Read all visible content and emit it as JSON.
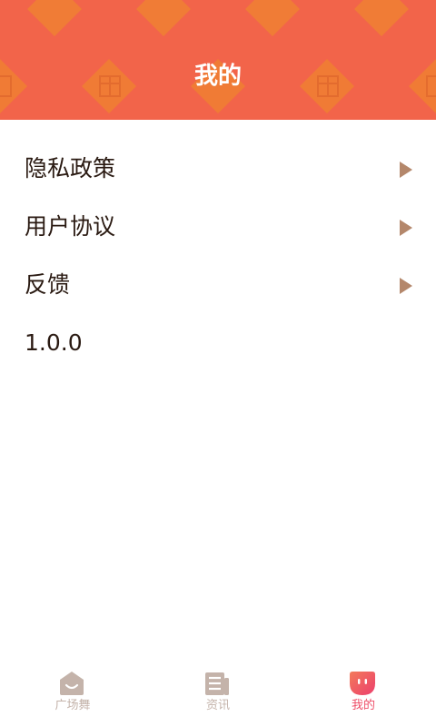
{
  "header": {
    "title": "我的"
  },
  "menu": {
    "items": [
      {
        "label": "隐私政策"
      },
      {
        "label": "用户协议"
      },
      {
        "label": "反馈"
      }
    ],
    "version": "1.0.0"
  },
  "nav": {
    "items": [
      {
        "label": "广场舞",
        "icon": "home-smile-icon",
        "active": false
      },
      {
        "label": "资讯",
        "icon": "news-icon",
        "active": false
      },
      {
        "label": "我的",
        "icon": "profile-face-icon",
        "active": true
      }
    ]
  },
  "colors": {
    "header_bg": "#F2644A",
    "pattern": "#F08032",
    "arrow": "#B4876B",
    "nav_inactive": "#C4B3AA",
    "nav_active": "#EE4D67"
  }
}
